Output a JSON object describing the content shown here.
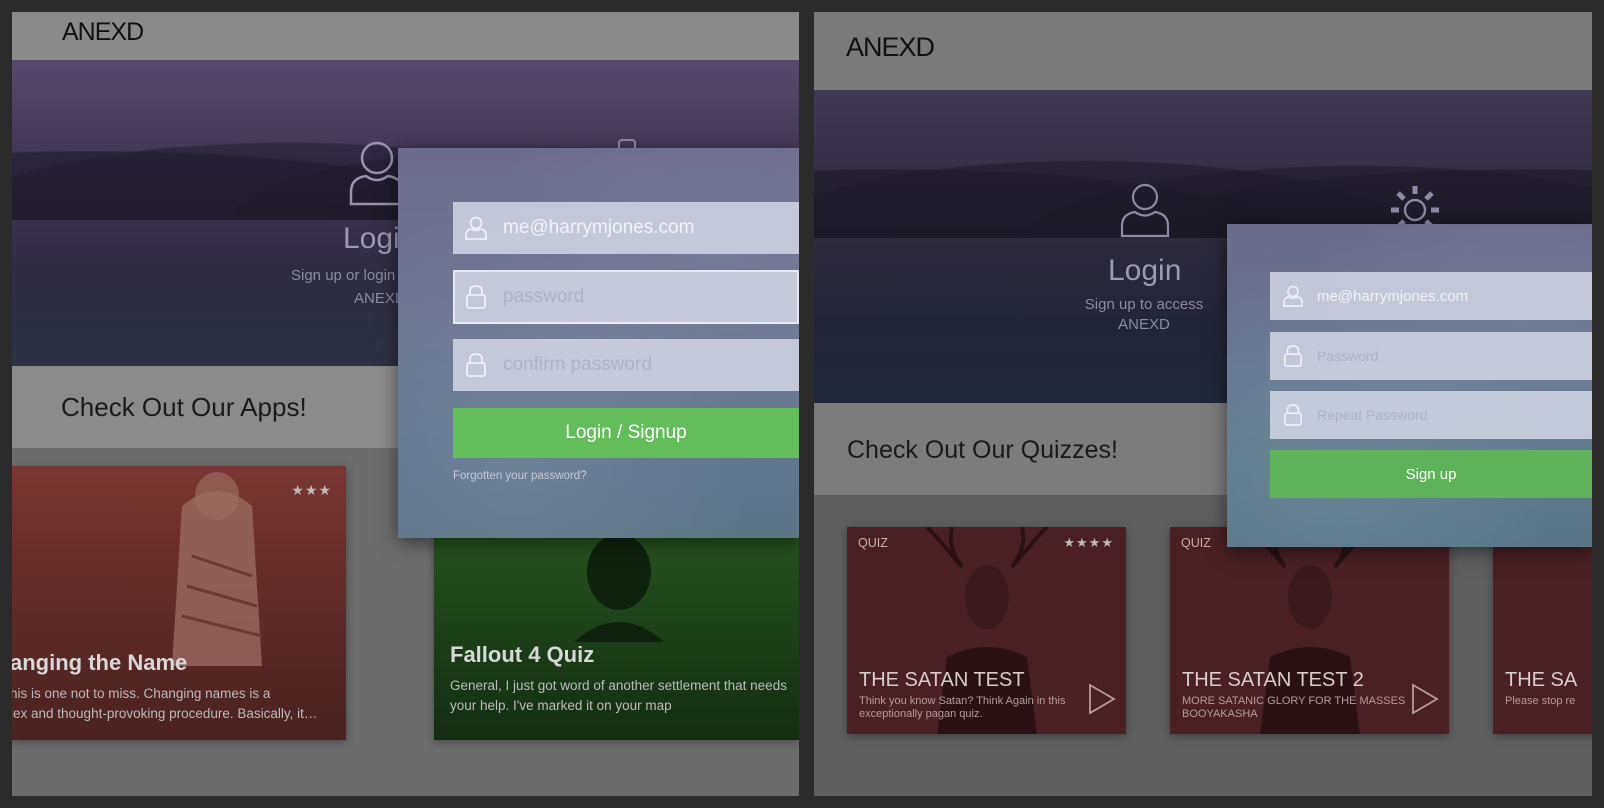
{
  "left": {
    "logo": "ANEXD",
    "hero": {
      "title": "Logi",
      "subtitle_line1": "Sign up or login",
      "subtitle_line2": "ANEXD"
    },
    "section_title": "Check Out Our Apps!",
    "form": {
      "email_value": "me@harrymjones.com",
      "password_placeholder": "password",
      "confirm_placeholder": "confirm password",
      "submit_label": "Login / Signup",
      "forgot_link": "Forgotten your password?"
    },
    "cards": [
      {
        "title": "anging the Name",
        "body_line1": "his is one not to miss. Changing names is a",
        "body_line2": "lex and thought-provoking procedure. Basically, it…",
        "stars": "★★★",
        "color": "#6b2f2c"
      },
      {
        "title": "Fallout 4 Quiz",
        "body_line1": "General, I just got word of another settlement that needs",
        "body_line2": "your help. I've marked it on your map",
        "color": "#1f4a1c"
      }
    ]
  },
  "right": {
    "logo": "ANEXD",
    "hero": {
      "title": "Login",
      "subtitle_line1": "Sign up to access",
      "subtitle_line2": "ANEXD"
    },
    "section_title": "Check Out Our Quizzes!",
    "form": {
      "email_value": "me@harrymjones.com",
      "password_placeholder": "Password",
      "repeat_placeholder": "Repeat Password",
      "submit_label": "Sign up"
    },
    "cards": [
      {
        "tag": "QUIZ",
        "stars": "★★★★",
        "title": "THE SATAN TEST",
        "body_line1": "Think you know Satan? Think Again in this",
        "body_line2": "exceptionally pagan quiz."
      },
      {
        "tag": "QUIZ",
        "title": "THE SATAN TEST 2",
        "body_line1": "MORE SATANIC GLORY FOR THE MASSES",
        "body_line2": "BOOYAKASHA"
      },
      {
        "title": "THE SA",
        "body_line1": "Please stop re"
      }
    ],
    "card_color": "#4a2024"
  }
}
